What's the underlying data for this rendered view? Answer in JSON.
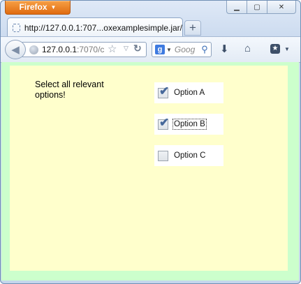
{
  "browser": {
    "menu_button_label": "Firefox",
    "window_controls": {
      "minimize": "▁",
      "maximize": "▢",
      "close": "✕"
    },
    "tab": {
      "title": "http://127.0.0.1:707...oxexamplesimple.jar/"
    },
    "new_tab_label": "+",
    "address_bar": {
      "host": "127.0.0.1",
      "rest": ":7070/c"
    },
    "search_bar": {
      "engine_letter": "g",
      "placeholder": "Goog"
    }
  },
  "page": {
    "question": "Select all relevant options!",
    "options": [
      {
        "label": "Option A",
        "checked": true,
        "focused": false
      },
      {
        "label": "Option B",
        "checked": true,
        "focused": true
      },
      {
        "label": "Option C",
        "checked": false,
        "focused": false
      }
    ],
    "colors": {
      "outer_background": "#ccffcc",
      "panel_background": "#ffffcc",
      "firefox_button": "#e8781a"
    }
  }
}
